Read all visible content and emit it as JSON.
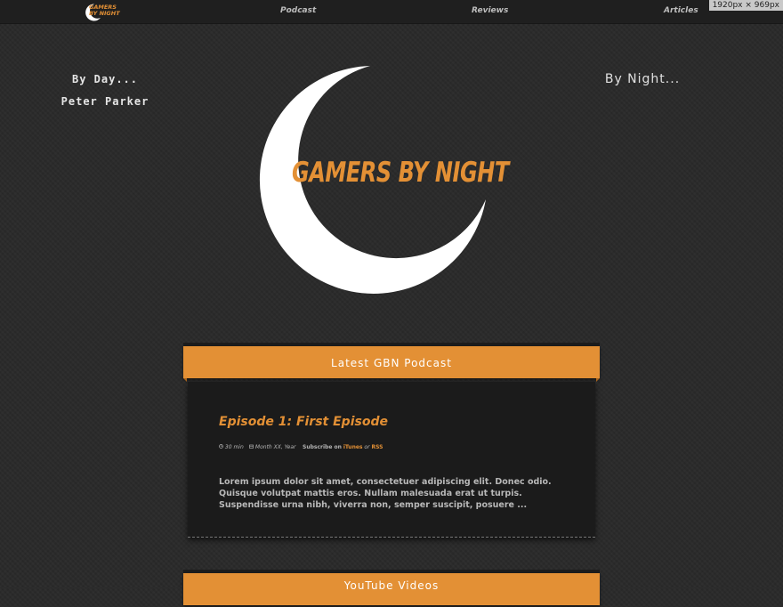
{
  "nav": {
    "logo_line1": "GAMERS",
    "logo_line2": "BY NIGHT",
    "links": [
      "Podcast",
      "Reviews",
      "Articles"
    ]
  },
  "viewport_badge": "1920px × 969px",
  "by_day": {
    "heading": "By Day...",
    "name": "Peter Parker"
  },
  "by_night": {
    "heading": "By Night..."
  },
  "hero": {
    "title": "GAMERS BY NIGHT"
  },
  "podcast": {
    "header": "Latest GBN Podcast",
    "episode_title": "Episode 1: First Episode",
    "duration": "30 min",
    "date": "Month XX, Year",
    "subscribe_label": "Subscribe on",
    "subscribe_itunes": "iTunes",
    "subscribe_or": "or",
    "subscribe_rss": "RSS",
    "excerpt": "Lorem ipsum dolor sit amet, consectetuer adipiscing elit. Donec odio. Quisque volutpat mattis eros. Nullam malesuada erat ut turpis. Suspendisse urna nibh, viverra non, semper suscipit, posuere ..."
  },
  "youtube": {
    "header": "YouTube Videos"
  },
  "colors": {
    "accent": "#e39035",
    "background": "#2b2b2b",
    "topbar": "#1f1f1f",
    "card": "#1b1b1b"
  },
  "icons": [
    "crescent-moon-icon",
    "clock-icon",
    "calendar-icon"
  ]
}
